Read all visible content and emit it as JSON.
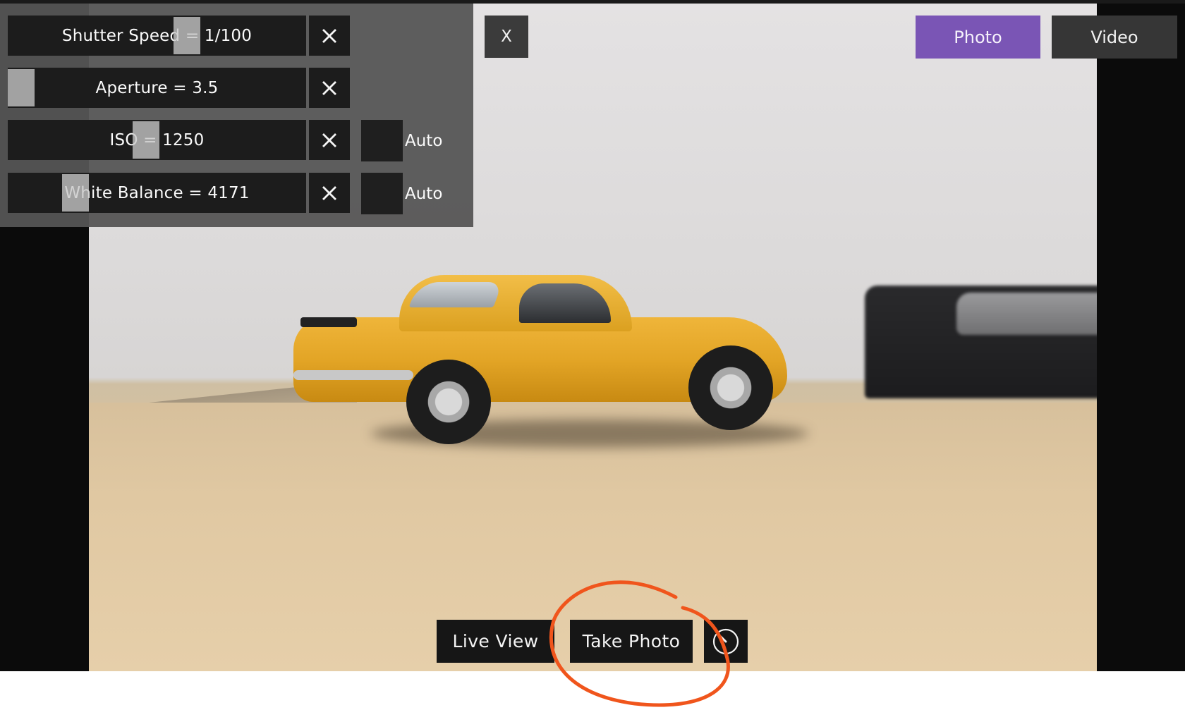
{
  "camera": {
    "sliders": [
      {
        "label": "Shutter Speed = 1/100",
        "level": 0.61
      },
      {
        "label": "Aperture = 3.5",
        "level": 0.0
      },
      {
        "label": "ISO = 1250",
        "level": 0.46
      },
      {
        "label": "White Balance = 4171",
        "level": 0.2
      }
    ],
    "auto_labels": [
      "Auto",
      "Auto"
    ],
    "close_label": "X",
    "modes": {
      "photo": "Photo",
      "video": "Video",
      "active": "photo"
    },
    "actions": {
      "live_view": "Live View",
      "take_photo": "Take Photo"
    },
    "timer_icon": "timer-icon",
    "clear_icon": "clear-x-icon"
  },
  "colors": {
    "accent": "#7a55b5",
    "annotation": "#f0551c"
  }
}
